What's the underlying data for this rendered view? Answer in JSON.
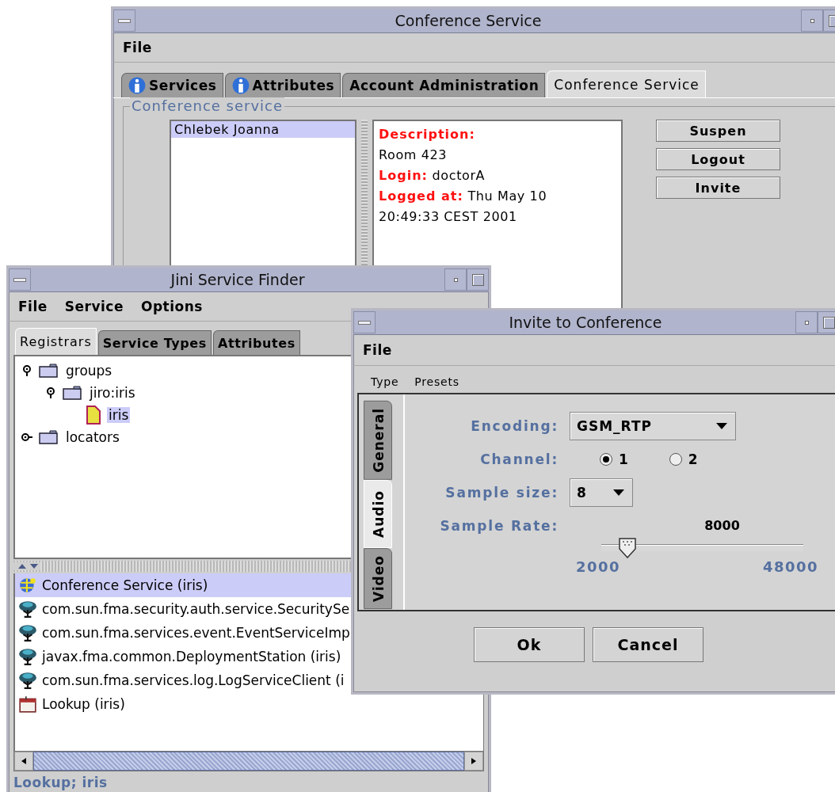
{
  "conference_window": {
    "title": "Conference Service",
    "menu": [
      "File"
    ],
    "tabs": [
      {
        "label": "Services",
        "kind": "info",
        "selected": false
      },
      {
        "label": "Attributes",
        "kind": "info",
        "selected": false
      },
      {
        "label": "Account Administration",
        "kind": "plain",
        "selected": false
      },
      {
        "label": "Conference Service",
        "kind": "plain",
        "selected": true
      }
    ],
    "group_title": "Conference service",
    "participants": [
      {
        "name": "Chlebek Joanna",
        "selected": true
      }
    ],
    "details": [
      "**Description:**",
      "Room 423",
      "**Login:** doctorA",
      "**Logged at:** Thu May 10 20:49:33 CEST 2001"
    ],
    "buttons": [
      "Suspen",
      "Logout",
      "Invite"
    ]
  },
  "finder_window": {
    "title": "Jini Service Finder",
    "menu": [
      "File",
      "Service",
      "Options"
    ],
    "tabs": [
      {
        "label": "Registrars",
        "selected": true
      },
      {
        "label": "Service Types",
        "selected": false
      },
      {
        "label": "Attributes",
        "selected": false
      }
    ],
    "tree": [
      {
        "label": "groups",
        "kind": "folder",
        "expanded": true,
        "selected": false,
        "children": [
          {
            "label": "jiro:iris",
            "kind": "folder",
            "expanded": true,
            "selected": false,
            "children": [
              {
                "label": "iris",
                "kind": "document",
                "selected": true
              }
            ]
          }
        ]
      },
      {
        "label": "locators",
        "kind": "folder",
        "expanded": false,
        "selected": false
      }
    ],
    "services": [
      {
        "label": "Conference Service (iris)",
        "kind": "conference",
        "selected": true
      },
      {
        "label": "com.sun.fma.security.auth.service.SecuritySe",
        "kind": "service",
        "selected": false
      },
      {
        "label": "com.sun.fma.services.event.EventServiceImp",
        "kind": "service",
        "selected": false
      },
      {
        "label": "javax.fma.common.DeploymentStation (iris)",
        "kind": "service",
        "selected": false
      },
      {
        "label": "com.sun.fma.services.log.LogServiceClient (i",
        "kind": "service",
        "selected": false
      },
      {
        "label": "Lookup (iris)",
        "kind": "lookup",
        "selected": false
      }
    ],
    "status": "Lookup; iris"
  },
  "invite_window": {
    "title": "Invite to Conference",
    "menu": [
      "File"
    ],
    "toolbar": [
      "Type",
      "Presets"
    ],
    "side_tabs": [
      {
        "label": "General",
        "selected": false
      },
      {
        "label": "Audio",
        "selected": true
      },
      {
        "label": "Video",
        "selected": false
      }
    ],
    "encoding": {
      "label": "Encoding:",
      "value": "GSM_RTP"
    },
    "channel": {
      "label": "Channel:",
      "options": [
        {
          "label": "1",
          "selected": true
        },
        {
          "label": "2",
          "selected": false
        }
      ]
    },
    "sample_size": {
      "label": "Sample size:",
      "value": "8"
    },
    "sample_rate": {
      "label": "Sample Rate:",
      "reading": "8000",
      "level": 0.13,
      "min": "2000",
      "max": "48000"
    },
    "buttons": [
      "Ok",
      "Cancel"
    ]
  }
}
